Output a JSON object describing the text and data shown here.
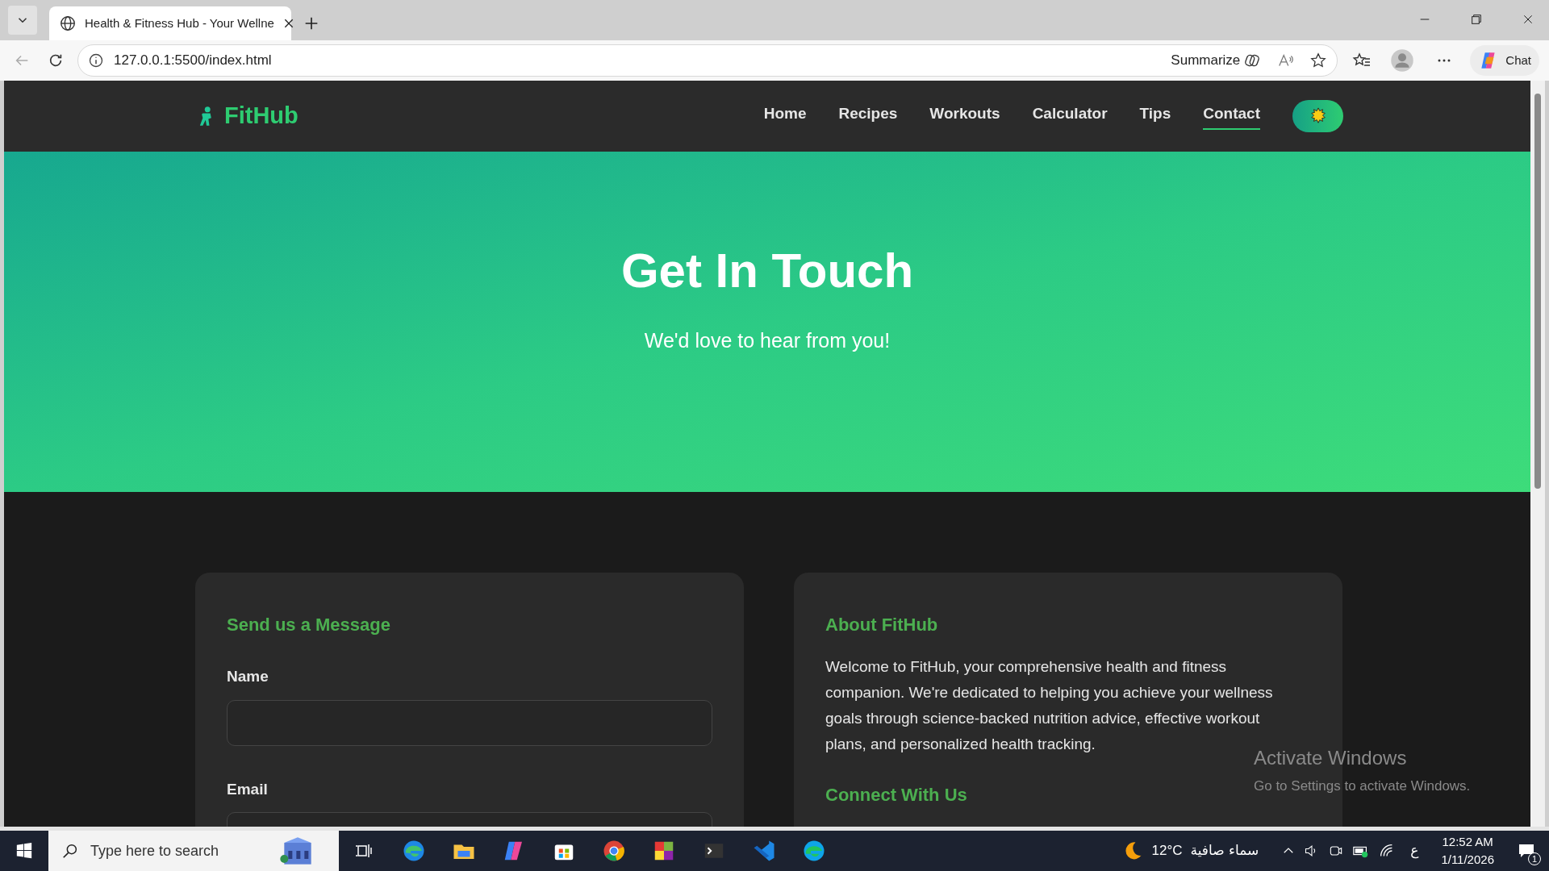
{
  "browser": {
    "tab_title": "Health & Fitness Hub - Your Wellne",
    "url": "127.0.0.1:5500/index.html",
    "summarize": "Summarize",
    "chat": "Chat"
  },
  "navbar": {
    "logo": "FitHub",
    "links": [
      {
        "label": "Home",
        "selected": false
      },
      {
        "label": "Recipes",
        "selected": false
      },
      {
        "label": "Workouts",
        "selected": false
      },
      {
        "label": "Calculator",
        "selected": false
      },
      {
        "label": "Tips",
        "selected": false
      },
      {
        "label": "Contact",
        "selected": true
      }
    ],
    "theme_toggle": {
      "on": true
    }
  },
  "hero": {
    "title": "Get In Touch",
    "subtitle": "We'd love to hear from you!"
  },
  "form_card": {
    "title": "Send us a Message",
    "fields": [
      {
        "label": "Name"
      },
      {
        "label": "Email"
      }
    ]
  },
  "about_card": {
    "title": "About FitHub",
    "text": "Welcome to FitHub, your comprehensive health and fitness companion. We're dedicated to helping you achieve your wellness goals through science-backed nutrition advice, effective workout plans, and personalized health tracking.",
    "subtitle": "Connect With Us"
  },
  "activation": {
    "title": "Activate Windows",
    "text": "Go to Settings to activate Windows."
  },
  "taskbar": {
    "search_placeholder": "Type here to search",
    "temperature": "12°C",
    "weather": "سماء صافية",
    "language": "ع",
    "time": "12:52 AM",
    "date": "1/11/2026",
    "notifications": "1"
  }
}
